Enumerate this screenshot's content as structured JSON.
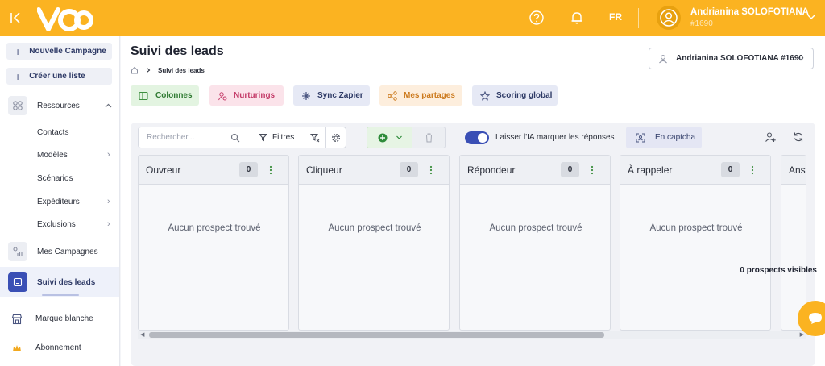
{
  "header": {
    "language": "FR",
    "user_name": "Andrianina SOLOFOTIANA",
    "user_id": "#1690",
    "icons": [
      "collapse-icon",
      "logo",
      "help-icon",
      "bell-icon",
      "user-avatar-icon",
      "chevron-down-icon"
    ]
  },
  "sidebar": {
    "new_campaign": "Nouvelle Campagne",
    "create_list": "Créer une liste",
    "resources": "Ressources",
    "sub_items": [
      "Contacts",
      "Modèles",
      "Scénarios",
      "Expéditeurs",
      "Exclusions"
    ],
    "my_campaigns": "Mes Campagnes",
    "lead_tracking": "Suivi des leads",
    "white_label": "Marque blanche",
    "subscription": "Abonnement"
  },
  "page": {
    "title": "Suivi des leads",
    "breadcrumb_current": "Suivi des leads",
    "owner_select": "Andrianina SOLOFOTIANA #1690"
  },
  "actions": {
    "columns": "Colonnes",
    "nurturings": "Nurturings",
    "sync_zapier": "Sync Zapier",
    "my_shares": "Mes partages",
    "global_scoring": "Scoring global"
  },
  "toolbar": {
    "search_placeholder": "Rechercher...",
    "filters": "Filtres",
    "ai_toggle_label": "Laisser l'IA marquer les réponses",
    "ai_toggle_on": true,
    "captcha": "En captcha"
  },
  "columns": [
    {
      "title": "Ouvreur",
      "count": "0",
      "empty": "Aucun prospect trouvé"
    },
    {
      "title": "Cliqueur",
      "count": "0",
      "empty": "Aucun prospect trouvé"
    },
    {
      "title": "Répondeur",
      "count": "0",
      "empty": "Aucun prospect trouvé"
    },
    {
      "title": "À rappeler",
      "count": "0",
      "empty": "Aucun prospect trouvé"
    },
    {
      "title": "Answ",
      "count": "",
      "empty": ""
    }
  ],
  "footer": {
    "visible_count": "0 prospects visibles"
  },
  "colors": {
    "brand": "#fbb321",
    "accent": "#3a4fb5"
  }
}
